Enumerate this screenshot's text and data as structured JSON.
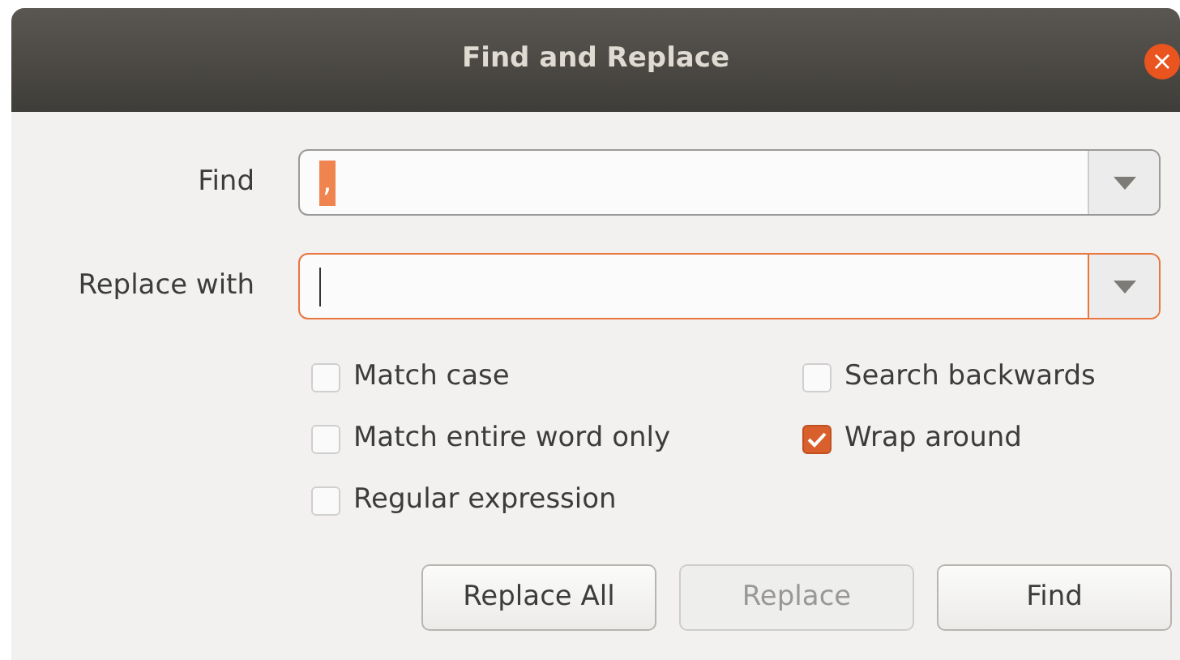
{
  "window": {
    "title": "Find and Replace",
    "close": "×"
  },
  "fields": [
    {
      "label": "Find",
      "value": ",",
      "selected_text": true,
      "focused": false
    },
    {
      "label": "Replace with",
      "focused": true
    }
  ],
  "options": [
    {
      "label": "Match case",
      "checked": false
    },
    {
      "label": "Search backwards",
      "checked": false
    },
    {
      "label": "Match entire word only",
      "checked": false
    },
    {
      "label": "Wrap around",
      "checked": true
    },
    {
      "label": "Regular expression",
      "checked": false
    }
  ],
  "buttons": [
    {
      "label": "Replace All",
      "disabled": false
    },
    {
      "label": "Replace",
      "disabled": true
    },
    {
      "label": "Find",
      "disabled": false
    }
  ]
}
